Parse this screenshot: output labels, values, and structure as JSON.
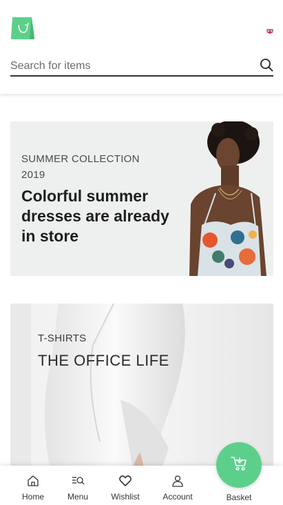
{
  "header": {
    "logo_icon": "shopping-bag-logo",
    "language_flag": "uk-flag",
    "search": {
      "placeholder": "Search for items"
    }
  },
  "banners": [
    {
      "subtitle": "SUMMER COLLECTION 2019",
      "title": "Colorful summer dresses are already in store"
    },
    {
      "subtitle": "T-SHIRTS",
      "title": "THE OFFICE LIFE"
    }
  ],
  "bottom_nav": {
    "items": [
      {
        "label": "Home",
        "icon": "home-icon"
      },
      {
        "label": "Menu",
        "icon": "menu-search-icon"
      },
      {
        "label": "Wishlist",
        "icon": "heart-icon"
      },
      {
        "label": "Account",
        "icon": "user-icon"
      },
      {
        "label": "Basket",
        "icon": "cart-icon"
      }
    ]
  },
  "colors": {
    "accent": "#5cd08b",
    "banner_bg": "#eef0ef",
    "text_dark": "#1e1e1e"
  }
}
